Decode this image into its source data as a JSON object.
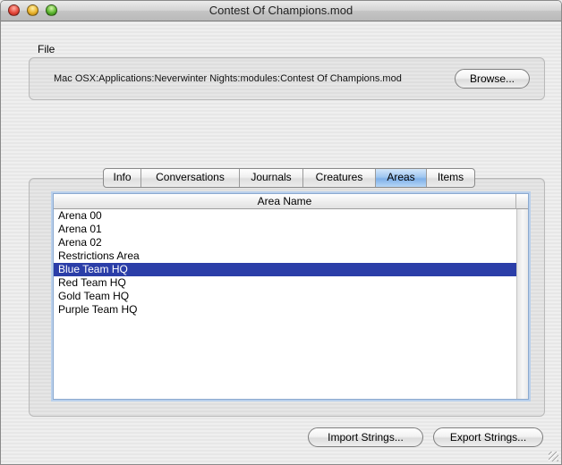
{
  "window": {
    "title": "Contest Of Champions.mod"
  },
  "file_section": {
    "label": "File",
    "path": "Mac OSX:Applications:Neverwinter Nights:modules:Contest Of Champions.mod",
    "browse_label": "Browse..."
  },
  "tabs": [
    {
      "label": "Info",
      "active": false
    },
    {
      "label": "Conversations",
      "active": false
    },
    {
      "label": "Journals",
      "active": false
    },
    {
      "label": "Creatures",
      "active": false
    },
    {
      "label": "Areas",
      "active": true
    },
    {
      "label": "Items",
      "active": false
    }
  ],
  "table": {
    "column_header": "Area Name",
    "rows": [
      {
        "name": "Arena 00",
        "selected": false
      },
      {
        "name": "Arena 01",
        "selected": false
      },
      {
        "name": "Arena 02",
        "selected": false
      },
      {
        "name": "Restrictions Area",
        "selected": false
      },
      {
        "name": "Blue Team HQ",
        "selected": true
      },
      {
        "name": "Red Team HQ",
        "selected": false
      },
      {
        "name": "Gold Team HQ",
        "selected": false
      },
      {
        "name": "Purple Team HQ",
        "selected": false
      }
    ]
  },
  "footer": {
    "import_label": "Import Strings...",
    "export_label": "Export Strings..."
  },
  "colors": {
    "selection": "#2b3ea8",
    "active_tab": "#9fc6f0",
    "focus_ring": "#b9d0ec"
  }
}
